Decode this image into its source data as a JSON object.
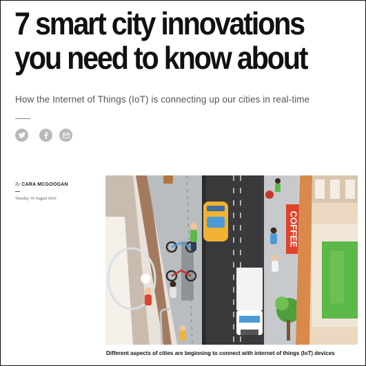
{
  "article": {
    "headline": "7 smart city innovations you need to know about",
    "subheadline": "How the Internet of Things (IoT) is connecting up our cities in real-time",
    "share_icons": [
      {
        "name": "twitter-icon",
        "label": "Twitter"
      },
      {
        "name": "facebook-icon",
        "label": "Facebook"
      },
      {
        "name": "email-icon",
        "label": "Email"
      }
    ],
    "byline": {
      "prefix": "By",
      "author": "CARA MCGOOGAN",
      "date": "Tuesday 16 August 2016"
    },
    "image": {
      "shop_sign": "COFFEE",
      "caption": "Different aspects of cities are beginning to connect with internet of things (IoT) devices"
    }
  },
  "colors": {
    "text": "#111111",
    "subtle_text": "#555555",
    "share_icon_bg": "#b9b9b9",
    "road": "#3a3a3c",
    "taxi": "#f2b233",
    "coffee_sign": "#e0432b",
    "grass": "#5cb848"
  }
}
